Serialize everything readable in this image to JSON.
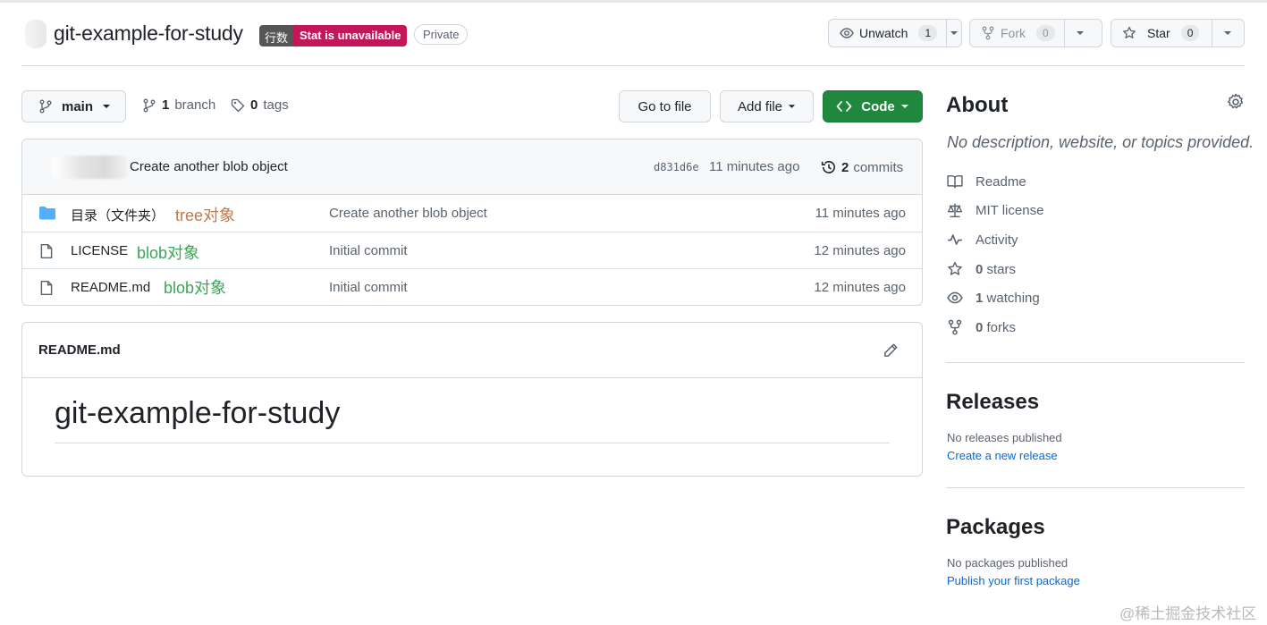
{
  "repo": {
    "name": "git-example-for-study",
    "badge_left": "行数",
    "badge_right": "Stat is unavailable",
    "visibility": "Private"
  },
  "header_actions": {
    "unwatch_label": "Unwatch",
    "unwatch_count": "1",
    "fork_label": "Fork",
    "fork_count": "0",
    "star_label": "Star",
    "star_count": "0"
  },
  "toolbar": {
    "branch": "main",
    "branch_count": "1",
    "branch_word": "branch",
    "tag_count": "0",
    "tag_word": "tags",
    "go_to_file": "Go to file",
    "add_file": "Add file",
    "code": "Code"
  },
  "latest_commit": {
    "message": "Create another blob object",
    "sha": "d831d6e",
    "time": "11 minutes ago",
    "count": "2",
    "count_word": "commits"
  },
  "files": [
    {
      "icon": "folder-icon",
      "name": "目录（文件夹）",
      "note": "tree对象",
      "message": "Create another blob object",
      "age": "11 minutes ago"
    },
    {
      "icon": "file-icon",
      "name": "LICENSE",
      "note": "blob对象",
      "message": "Initial commit",
      "age": "12 minutes ago"
    },
    {
      "icon": "file-icon",
      "name": "README.md",
      "note": "blob对象",
      "message": "Initial commit",
      "age": "12 minutes ago"
    }
  ],
  "readme": {
    "filename": "README.md",
    "heading": "git-example-for-study"
  },
  "about": {
    "title": "About",
    "description": "No description, website, or topics provided.",
    "readme": "Readme",
    "license": "MIT license",
    "activity": "Activity",
    "stars_count": "0",
    "stars_word": "stars",
    "watching_count": "1",
    "watching_word": "watching",
    "forks_count": "0",
    "forks_word": "forks"
  },
  "releases": {
    "title": "Releases",
    "empty": "No releases published",
    "link": "Create a new release"
  },
  "packages": {
    "title": "Packages",
    "empty": "No packages published",
    "link": "Publish your first package"
  },
  "watermark": "@稀土掘金技术社区",
  "colors": {
    "accent": "#1f883d",
    "link": "#0969da",
    "badge": "#c2185b",
    "tree_note": "#c07a48",
    "blob_note": "#3aa657"
  }
}
